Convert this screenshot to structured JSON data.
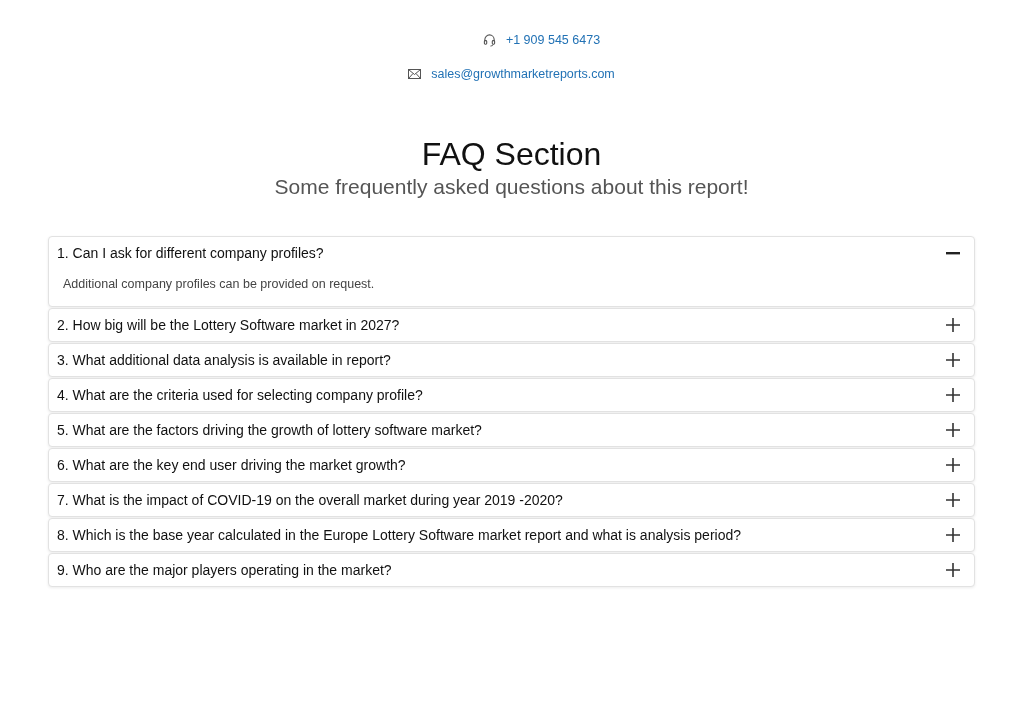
{
  "contact": {
    "phone": "+1 909 545 6473",
    "email": "sales@growthmarketreports.com"
  },
  "header": {
    "title": "FAQ Section",
    "subtitle": "Some frequently asked questions about this report!"
  },
  "faq": [
    {
      "question": "1. Can I ask for different company profiles?",
      "expanded": true,
      "answer": "Additional company profiles can be provided on request."
    },
    {
      "question": "2. How big will be the Lottery Software market in 2027?",
      "expanded": false
    },
    {
      "question": "3. What additional data analysis is available in report?",
      "expanded": false
    },
    {
      "question": "4. What are the criteria used for selecting company profile?",
      "expanded": false
    },
    {
      "question": "5. What are the factors driving the growth of lottery software market?",
      "expanded": false
    },
    {
      "question": "6. What are the key end user driving the market growth?",
      "expanded": false
    },
    {
      "question": "7. What is the impact of COVID-19 on the overall market during year 2019 -2020?",
      "expanded": false
    },
    {
      "question": "8. Which is the base year calculated in the Europe Lottery Software market report and what is analysis period?",
      "expanded": false
    },
    {
      "question": "9. Who are the major players operating in the market?",
      "expanded": false
    }
  ]
}
